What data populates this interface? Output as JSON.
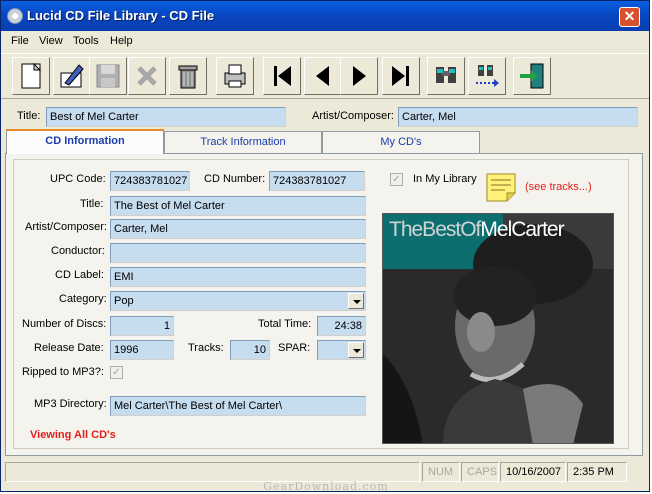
{
  "window": {
    "title": "Lucid CD File Library - CD File"
  },
  "menu": [
    "File",
    "View",
    "Tools",
    "Help"
  ],
  "toolbar": {
    "buttons": [
      "new-icon",
      "edit-icon",
      "save-icon",
      "delete-icon",
      "trash-icon",
      "print-icon",
      "first-record-icon",
      "previous-record-icon",
      "next-record-icon",
      "last-record-icon",
      "find-icon",
      "find-next-icon",
      "exit-icon"
    ]
  },
  "header": {
    "title_label": "Title:",
    "title_value": "Best of Mel Carter",
    "artist_label": "Artist/Composer:",
    "artist_value": "Carter, Mel"
  },
  "tabs": [
    "CD Information",
    "Track Information",
    "My CD's"
  ],
  "form": {
    "upc_label": "UPC Code:",
    "upc_value": "724383781027",
    "cdnum_label": "CD Number:",
    "cdnum_value": "724383781027",
    "title_label": "Title:",
    "title_value": "The Best of Mel Carter",
    "artist_label": "Artist/Composer:",
    "artist_value": "Carter, Mel",
    "conductor_label": "Conductor:",
    "conductor_value": "",
    "cdlabel_label": "CD Label:",
    "cdlabel_value": "EMI",
    "category_label": "Category:",
    "category_value": "Pop",
    "discs_label": "Number of Discs:",
    "discs_value": "1",
    "totaltime_label": "Total Time:",
    "totaltime_value": "24:38",
    "release_label": "Release Date:",
    "release_value": "1996",
    "tracks_label": "Tracks:",
    "tracks_value": "10",
    "spar_label": "SPAR:",
    "spar_value": "",
    "ripped_label": "Ripped to MP3?:",
    "mp3dir_label": "MP3 Directory:",
    "mp3dir_value": "Mel Carter\\The Best of Mel Carter\\",
    "viewing_text": "Viewing All CD's",
    "in_library_label": "In My Library",
    "see_tracks_link": "(see tracks...)"
  },
  "album": {
    "title_part1": "TheBestOf",
    "title_part2": "MelCarter"
  },
  "status": {
    "num": "NUM",
    "caps": "CAPS",
    "date": "10/16/2007",
    "time": "2:35 PM"
  },
  "watermark": "GearDownload.com",
  "colors": {
    "field_bg": "#c6dcef",
    "title_bar": "#0845c0",
    "link_red": "#e0201a",
    "tab_text": "#1a3ca8"
  }
}
